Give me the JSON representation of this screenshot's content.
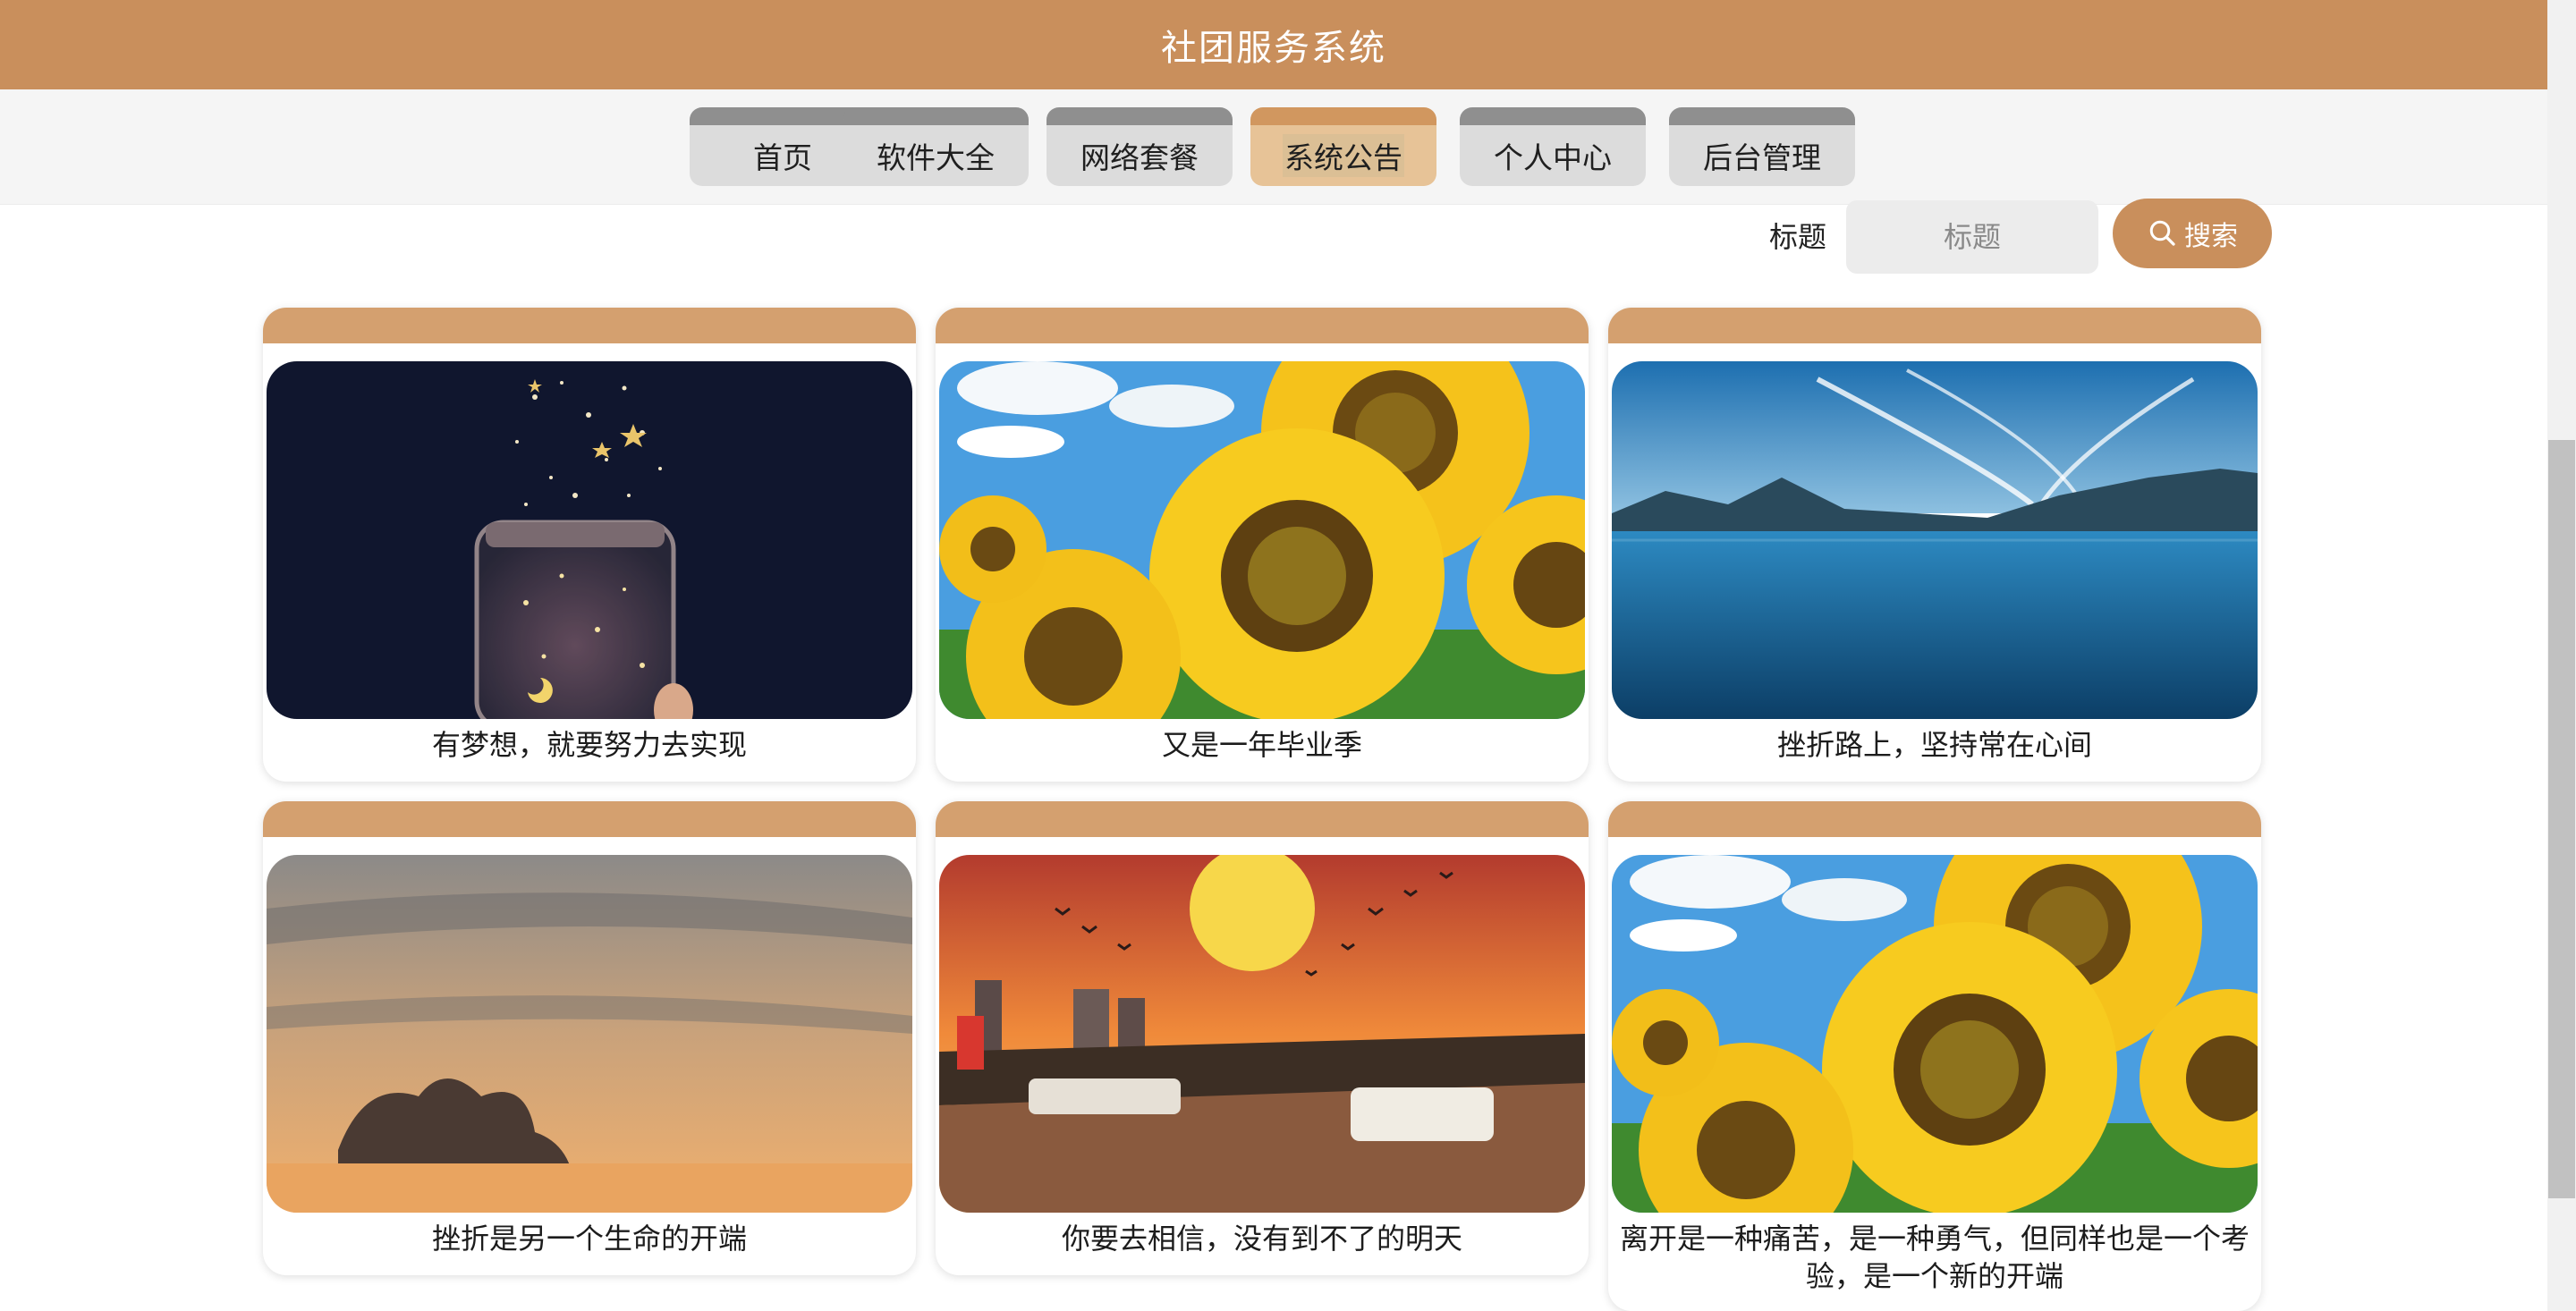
{
  "app": {
    "title": "社团服务系统"
  },
  "nav": {
    "items": [
      {
        "label": "首页",
        "active": false
      },
      {
        "label": "软件大全",
        "active": false
      },
      {
        "label": "网络套餐",
        "active": false
      },
      {
        "label": "系统公告",
        "active": true
      },
      {
        "label": "个人中心",
        "active": false
      },
      {
        "label": "后台管理",
        "active": false
      }
    ]
  },
  "search": {
    "label": "标题",
    "placeholder": "标题",
    "value": "",
    "button_label": "搜索",
    "button_icon": "search-icon"
  },
  "cards": [
    {
      "caption": "有梦想，就要努力去实现",
      "image": "starry-jar-photo"
    },
    {
      "caption": "又是一年毕业季",
      "image": "sunflowers-photo"
    },
    {
      "caption": "挫折路上，坚持常在心间",
      "image": "mountain-lake-photo"
    },
    {
      "caption": "挫折是另一个生命的开端",
      "image": "sunset-clouds-photo"
    },
    {
      "caption": "你要去相信，没有到不了的明天",
      "image": "river-sunset-photo"
    },
    {
      "caption": "离开是一种痛苦，是一种勇气，但同样也是一个考验，是一个新的开端",
      "image": "sunflowers-photo"
    }
  ],
  "colors": {
    "brand": "#c98f5c",
    "card_band": "#d4a06f",
    "nav_active": "#e7c397",
    "nav_inactive": "#dcdcdc"
  }
}
